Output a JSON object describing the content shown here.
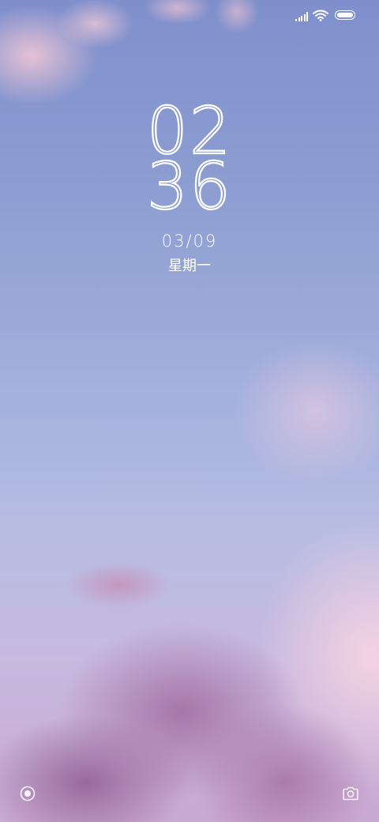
{
  "status_bar": {
    "icons": [
      "signal-icon",
      "wifi-icon",
      "battery-icon"
    ]
  },
  "lock_screen": {
    "clock_hours": "02",
    "clock_minutes": "36",
    "date": "03/09",
    "weekday": "星期一"
  },
  "shortcuts": {
    "left_icon": "record-icon",
    "right_icon": "camera-icon"
  },
  "colors": {
    "text": "#ffffff",
    "sky_top": "#7f8fcc",
    "cloud_pink": "#ecc4d6",
    "cloud_purple": "#a573a5"
  }
}
